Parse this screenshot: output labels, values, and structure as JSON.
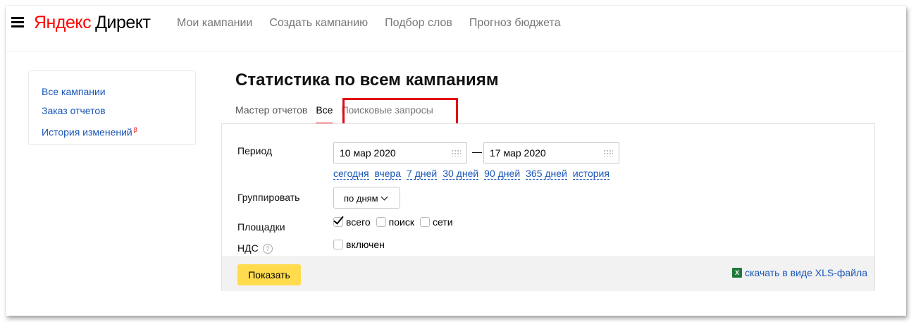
{
  "header": {
    "logo_brand": "Яндекс",
    "logo_product": "Директ",
    "nav": [
      "Мои кампании",
      "Создать кампанию",
      "Подбор слов",
      "Прогноз бюджета"
    ]
  },
  "sidebar": {
    "items": [
      {
        "label": "Все кампании"
      },
      {
        "label": "Заказ отчетов"
      },
      {
        "label": "История изменений",
        "badge": "β"
      }
    ]
  },
  "main": {
    "title": "Статистика по всем кампаниям",
    "tabs": [
      {
        "label": "Мастер отчетов"
      },
      {
        "label": "Все"
      },
      {
        "label": "Поисковые запросы"
      }
    ]
  },
  "form": {
    "period_label": "Период",
    "date_from": "10 мар 2020",
    "date_to": "17 мар 2020",
    "dash": "—",
    "quick_periods": [
      "сегодня",
      "вчера",
      "7 дней",
      "30 дней",
      "90 дней",
      "365 дней",
      "история"
    ],
    "group_label": "Группировать",
    "group_value": "по дням",
    "platforms_label": "Площадки",
    "platforms": [
      {
        "label": "всего",
        "checked": true
      },
      {
        "label": "поиск",
        "checked": false
      },
      {
        "label": "сети",
        "checked": false
      }
    ],
    "vat_label": "НДС",
    "vat_help": "?",
    "vat_option": "включен",
    "show_button": "Показать",
    "xls_link": "скачать в виде XLS-файла",
    "xls_icon_text": "X"
  },
  "colors": {
    "accent_red": "#ff0000",
    "link_blue": "#1a56b8",
    "button_yellow": "#ffdb4d",
    "highlight_box": "#e30613"
  }
}
